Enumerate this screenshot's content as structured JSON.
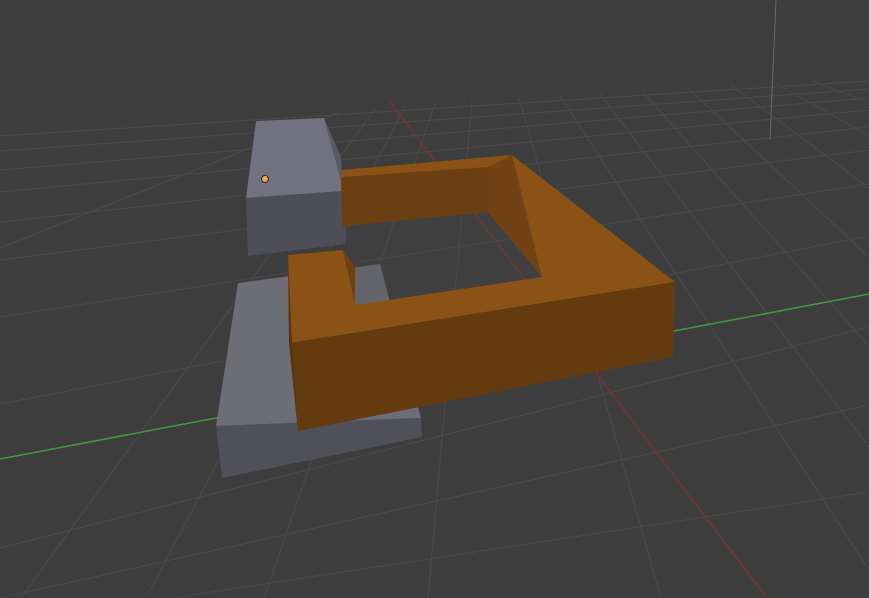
{
  "app": {
    "window_title": ""
  },
  "viewport": {
    "background_color": "#3d3d3d",
    "grid_color": "#4a4a4a",
    "x_axis_color": "#7a2f34",
    "y_axis_color": "#3f9b3f",
    "objects": [
      {
        "name": "front-gray-block",
        "selected": false,
        "colors": {
          "top": "#6d6d78",
          "front": "#50505b",
          "side": "#5c5c66"
        }
      },
      {
        "name": "back-gray-block",
        "selected": false,
        "colors": {
          "top": "#717180",
          "front": "#4e4e58",
          "side": "#5a5a64"
        }
      },
      {
        "name": "orange-frame",
        "selected": true,
        "colors": {
          "top": "#8b5216",
          "inner": "#6c3f12",
          "front": "#643a0f",
          "dark": "#5b330d"
        }
      }
    ],
    "origin_marker_color": "#f5a35a"
  }
}
